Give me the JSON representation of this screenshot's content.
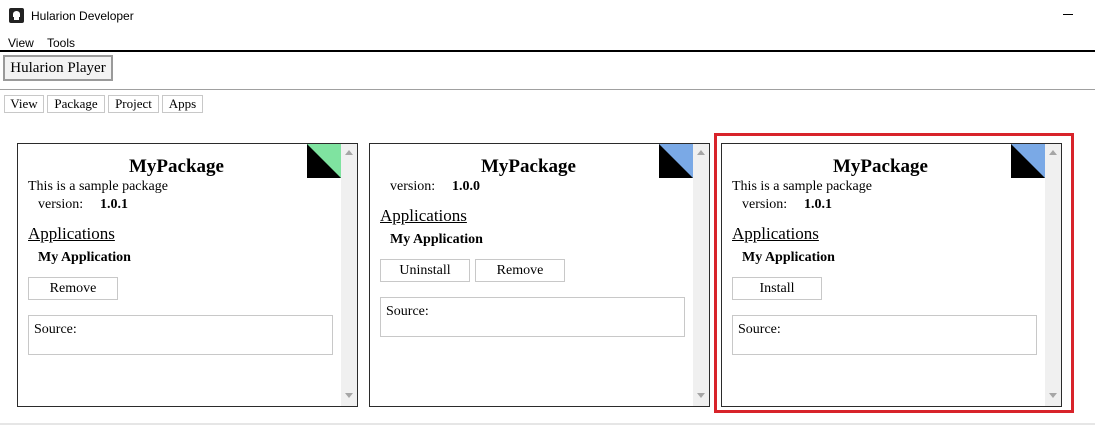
{
  "window": {
    "title": "Hularion Developer"
  },
  "menu": {
    "items": [
      "View",
      "Tools"
    ]
  },
  "player_tab": {
    "label": "Hularion Player"
  },
  "subtabs": [
    "View",
    "Package",
    "Project",
    "Apps"
  ],
  "cards": [
    {
      "title": "MyPackage",
      "description": "This is a sample package",
      "version_label": "version:",
      "version": "1.0.1",
      "applications_label": "Applications",
      "app_name": "My Application",
      "buttons": [
        "Remove"
      ],
      "source_label": "Source:",
      "corner_color": "#7fe3a0"
    },
    {
      "title": "MyPackage",
      "version_label": "version:",
      "version": "1.0.0",
      "applications_label": "Applications",
      "app_name": "My Application",
      "buttons": [
        "Uninstall",
        "Remove"
      ],
      "source_label": "Source:",
      "corner_color": "#7aa9e6"
    },
    {
      "title": "MyPackage",
      "description": "This is a sample package",
      "version_label": "version:",
      "version": "1.0.1",
      "applications_label": "Applications",
      "app_name": "My Application",
      "buttons": [
        "Install"
      ],
      "source_label": "Source:",
      "corner_color": "#7aa9e6"
    }
  ],
  "colors": {
    "highlight": "#d8232a",
    "card_border": "#2b2b2b"
  }
}
